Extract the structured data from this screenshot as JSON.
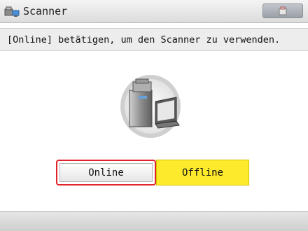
{
  "window": {
    "title": "Scanner",
    "title_icon": "scanner-app-icon",
    "top_right_button_icon": "device-status-icon"
  },
  "message": "[Online] betätigen, um den Scanner zu verwenden.",
  "illustration": "scanner-computer-icon",
  "buttons": {
    "online_label": "Online",
    "offline_label": "Offline"
  },
  "colors": {
    "online_focus_border": "#e0242a",
    "offline_background": "#fdea2c"
  }
}
